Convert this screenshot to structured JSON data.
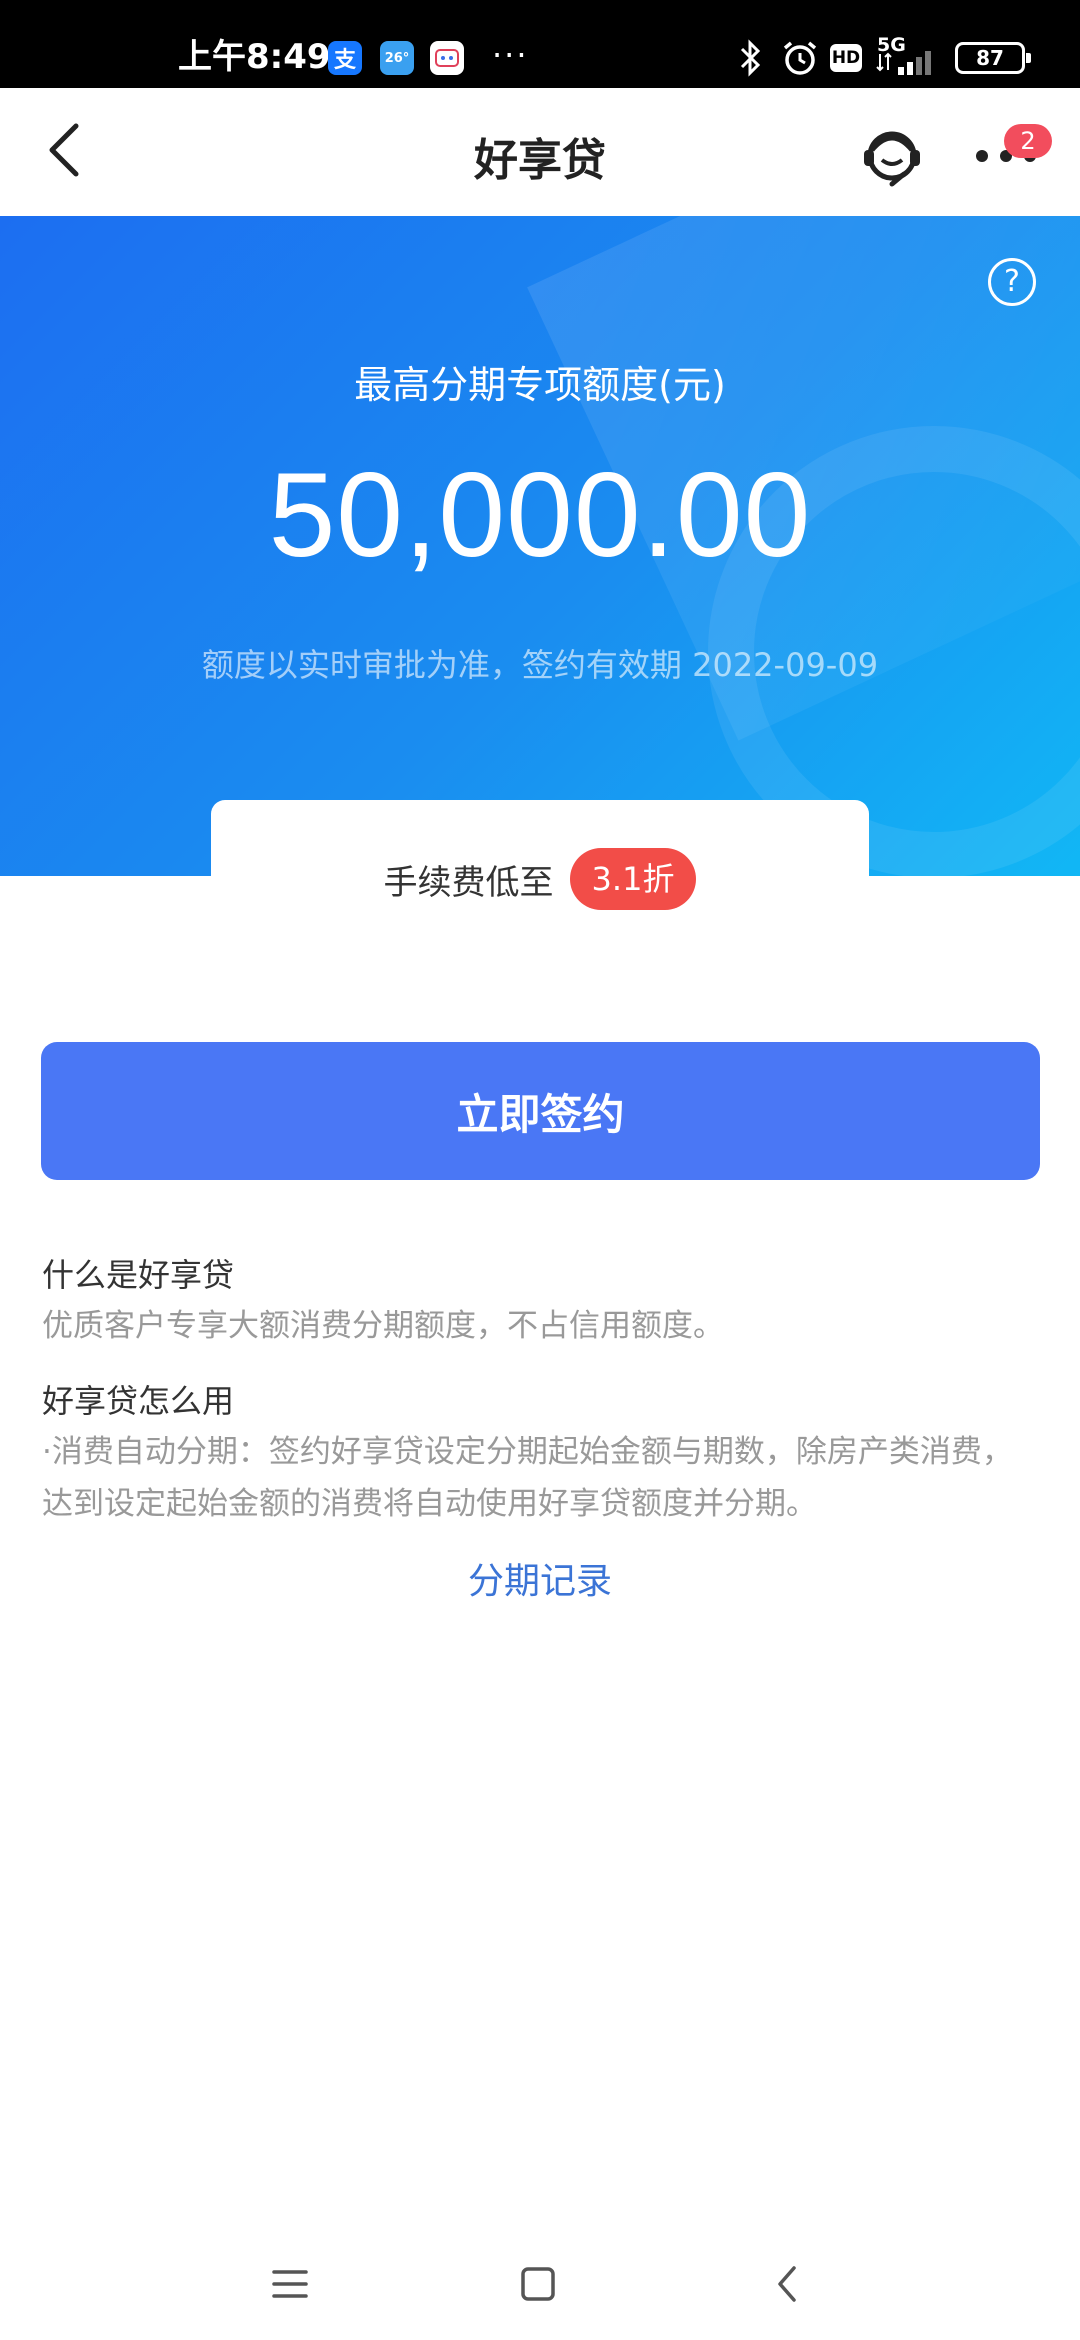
{
  "status_bar": {
    "time": "上午8:49",
    "app_icons": [
      "alipay-icon",
      "weather-icon",
      "app-icon"
    ],
    "weather_temp": "26°",
    "overflow": "···",
    "network": "5G",
    "hd": "HD",
    "battery": "87"
  },
  "header": {
    "title": "好享贷",
    "badge_count": "2"
  },
  "hero": {
    "label": "最高分期专项额度(元)",
    "amount": "50,000.00",
    "note": "额度以实时审批为准，签约有效期 2022-09-09",
    "help_symbol": "?",
    "colors": {
      "gradient_start": "#1c6ef1",
      "gradient_end": "#11b7f5"
    }
  },
  "fee": {
    "label": "手续费低至",
    "discount": "3.1折",
    "badge_color": "#f24d48"
  },
  "action": {
    "sign_label": "立即签约",
    "button_color": "#4a77f5"
  },
  "info": {
    "what_title": "什么是好享贷",
    "what_text": "优质客户专享大额消费分期额度，不占信用额度。",
    "how_title": "好享贷怎么用",
    "how_text": "·消费自动分期：签约好享贷设定分期起始金额与期数，除房产类消费，达到设定起始金额的消费将自动使用好享贷额度并分期。"
  },
  "links": {
    "history": "分期记录"
  },
  "nav": {
    "items": [
      "menu-icon",
      "home-icon",
      "back-icon"
    ]
  }
}
